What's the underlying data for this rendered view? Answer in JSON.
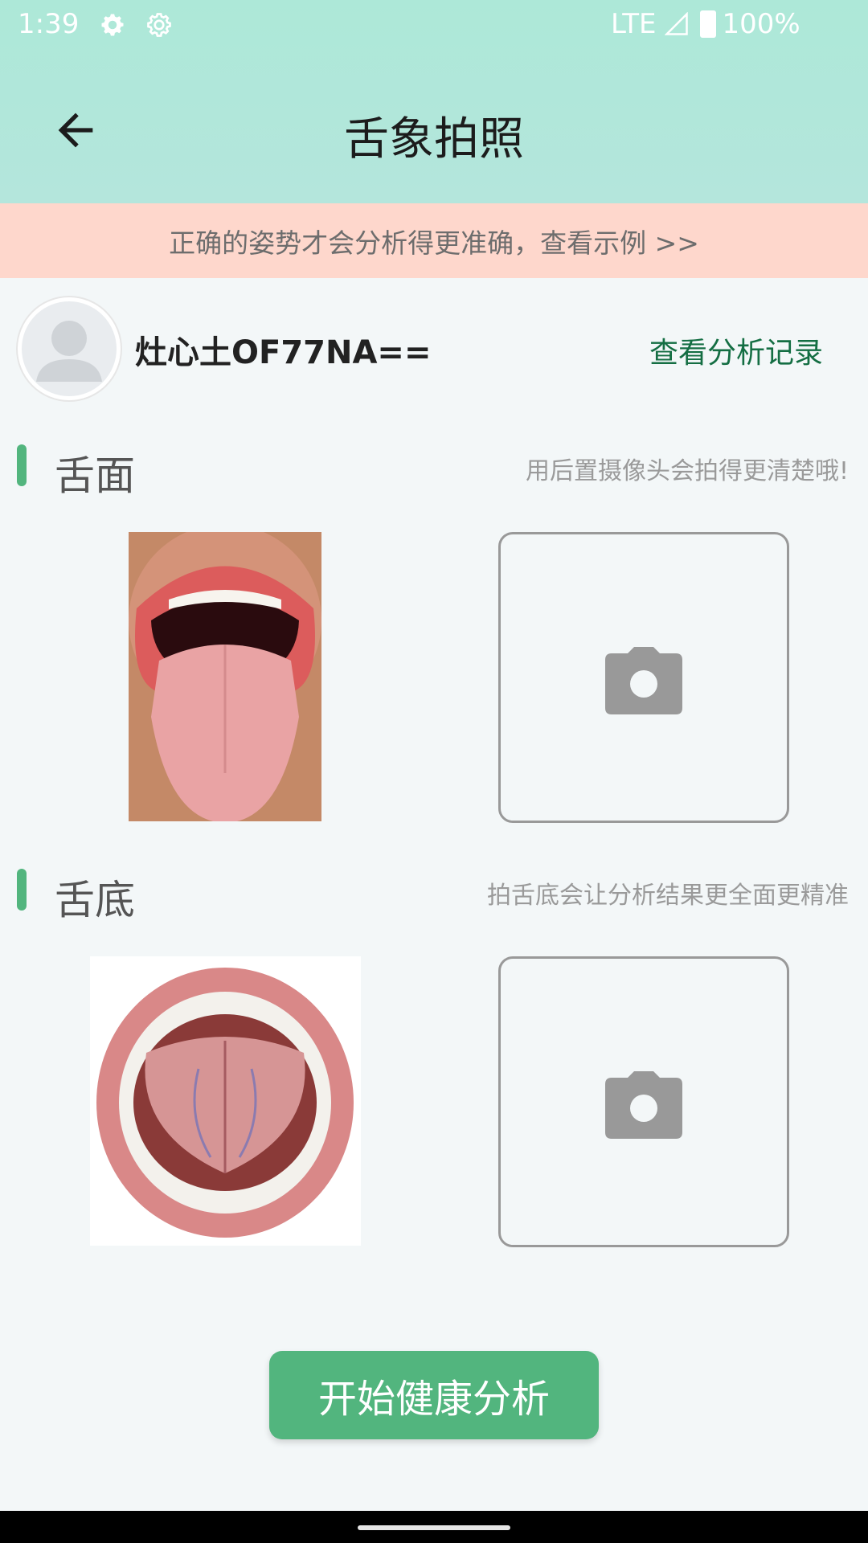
{
  "status_bar": {
    "time": "1:39",
    "network": "LTE",
    "battery": "100%",
    "icons": [
      "gear-icon",
      "gear-icon",
      "signal-icon",
      "battery-icon"
    ]
  },
  "header": {
    "title": "舌象拍照",
    "back_icon": "arrow-left-icon",
    "background": "#ade8d8"
  },
  "tip_banner": {
    "text": "正确的姿势才会分析得更准确，查看示例 >>",
    "background": "#fed7cc"
  },
  "user": {
    "name": "灶心土OF77NA==",
    "records_link": "查看分析记录"
  },
  "sections": [
    {
      "title": "舌面",
      "hint": "用后置摄像头会拍得更清楚哦!",
      "sample_image": "tongue-surface-sample",
      "upload_icon": "camera-icon"
    },
    {
      "title": "舌底",
      "hint": "拍舌底会让分析结果更全面更精准",
      "sample_image": "tongue-underside-sample",
      "upload_icon": "camera-icon"
    }
  ],
  "actions": {
    "start_label": "开始健康分析"
  },
  "colors": {
    "accent": "#52b57e",
    "link": "#146e43"
  }
}
